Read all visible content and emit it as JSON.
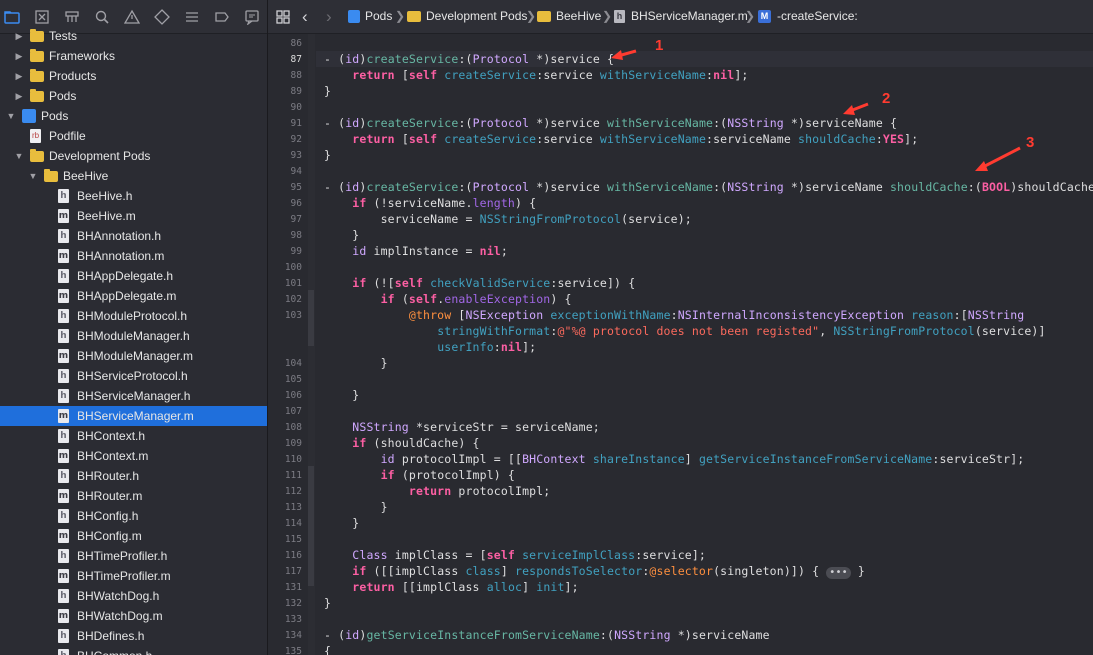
{
  "navigator": {
    "toolbar_icons": [
      "folder-icon",
      "source-control-icon",
      "symbol-icon",
      "find-icon",
      "warning-icon",
      "test-icon",
      "debug-icon",
      "breakpoint-icon",
      "report-icon"
    ],
    "rows": [
      {
        "label": "Tests",
        "kind": "folder",
        "depth": 1,
        "disclosure": "right"
      },
      {
        "label": "Frameworks",
        "kind": "folder",
        "depth": 1,
        "disclosure": "right"
      },
      {
        "label": "Products",
        "kind": "folder",
        "depth": 1,
        "disclosure": "right"
      },
      {
        "label": "Pods",
        "kind": "folder",
        "depth": 1,
        "disclosure": "right"
      },
      {
        "label": "Pods",
        "kind": "project",
        "depth": 0,
        "disclosure": "down"
      },
      {
        "label": "Podfile",
        "kind": "podfile",
        "depth": 1,
        "disclosure": "none"
      },
      {
        "label": "Development Pods",
        "kind": "folder",
        "depth": 1,
        "disclosure": "down"
      },
      {
        "label": "BeeHive",
        "kind": "folder",
        "depth": 2,
        "disclosure": "down"
      },
      {
        "label": "BeeHive.h",
        "kind": "h",
        "depth": 3
      },
      {
        "label": "BeeHive.m",
        "kind": "m",
        "depth": 3
      },
      {
        "label": "BHAnnotation.h",
        "kind": "h",
        "depth": 3
      },
      {
        "label": "BHAnnotation.m",
        "kind": "m",
        "depth": 3
      },
      {
        "label": "BHAppDelegate.h",
        "kind": "h",
        "depth": 3
      },
      {
        "label": "BHAppDelegate.m",
        "kind": "m",
        "depth": 3
      },
      {
        "label": "BHModuleProtocol.h",
        "kind": "h",
        "depth": 3
      },
      {
        "label": "BHModuleManager.h",
        "kind": "h",
        "depth": 3
      },
      {
        "label": "BHModuleManager.m",
        "kind": "m",
        "depth": 3
      },
      {
        "label": "BHServiceProtocol.h",
        "kind": "h",
        "depth": 3
      },
      {
        "label": "BHServiceManager.h",
        "kind": "h",
        "depth": 3
      },
      {
        "label": "BHServiceManager.m",
        "kind": "m",
        "depth": 3,
        "selected": true
      },
      {
        "label": "BHContext.h",
        "kind": "h",
        "depth": 3
      },
      {
        "label": "BHContext.m",
        "kind": "m",
        "depth": 3
      },
      {
        "label": "BHRouter.h",
        "kind": "h",
        "depth": 3
      },
      {
        "label": "BHRouter.m",
        "kind": "m",
        "depth": 3
      },
      {
        "label": "BHConfig.h",
        "kind": "h",
        "depth": 3
      },
      {
        "label": "BHConfig.m",
        "kind": "m",
        "depth": 3
      },
      {
        "label": "BHTimeProfiler.h",
        "kind": "h",
        "depth": 3
      },
      {
        "label": "BHTimeProfiler.m",
        "kind": "m",
        "depth": 3
      },
      {
        "label": "BHWatchDog.h",
        "kind": "h",
        "depth": 3
      },
      {
        "label": "BHWatchDog.m",
        "kind": "m",
        "depth": 3
      },
      {
        "label": "BHDefines.h",
        "kind": "h",
        "depth": 3
      },
      {
        "label": "BHCommon.h",
        "kind": "h",
        "depth": 3
      }
    ]
  },
  "jumpbar": {
    "crumbs": [
      "Pods",
      "Development Pods",
      "BeeHive",
      "BHServiceManager.m",
      "-createService:"
    ],
    "method_badge": "M",
    "file_badge": "h"
  },
  "editor": {
    "current_line": "87",
    "lines": [
      {
        "n": "86",
        "segs": []
      },
      {
        "n": "87",
        "segs": [
          [
            "p",
            "- ("
          ],
          [
            "t",
            "id"
          ],
          [
            "p",
            ")"
          ],
          [
            "f",
            "createService"
          ],
          [
            "p",
            ":("
          ],
          [
            "t",
            "Protocol"
          ],
          [
            "p",
            " *)service {"
          ]
        ]
      },
      {
        "n": "88",
        "segs": [
          [
            "p",
            "    "
          ],
          [
            "k",
            "return"
          ],
          [
            "p",
            " ["
          ],
          [
            "k",
            "self"
          ],
          [
            "p",
            " "
          ],
          [
            "m",
            "createService"
          ],
          [
            "p",
            ":service "
          ],
          [
            "m",
            "withServiceName"
          ],
          [
            "p",
            ":"
          ],
          [
            "k",
            "nil"
          ],
          [
            "p",
            "];"
          ]
        ]
      },
      {
        "n": "89",
        "segs": [
          [
            "p",
            "}"
          ]
        ]
      },
      {
        "n": "90",
        "segs": []
      },
      {
        "n": "91",
        "segs": [
          [
            "p",
            "- ("
          ],
          [
            "t",
            "id"
          ],
          [
            "p",
            ")"
          ],
          [
            "f",
            "createService"
          ],
          [
            "p",
            ":("
          ],
          [
            "t",
            "Protocol"
          ],
          [
            "p",
            " *)service "
          ],
          [
            "f",
            "withServiceName"
          ],
          [
            "p",
            ":("
          ],
          [
            "t",
            "NSString"
          ],
          [
            "p",
            " *)serviceName {"
          ]
        ]
      },
      {
        "n": "92",
        "segs": [
          [
            "p",
            "    "
          ],
          [
            "k",
            "return"
          ],
          [
            "p",
            " ["
          ],
          [
            "k",
            "self"
          ],
          [
            "p",
            " "
          ],
          [
            "m",
            "createService"
          ],
          [
            "p",
            ":service "
          ],
          [
            "m",
            "withServiceName"
          ],
          [
            "p",
            ":serviceName "
          ],
          [
            "m",
            "shouldCache"
          ],
          [
            "p",
            ":"
          ],
          [
            "k",
            "YES"
          ],
          [
            "p",
            "];"
          ]
        ]
      },
      {
        "n": "93",
        "segs": [
          [
            "p",
            "}"
          ]
        ]
      },
      {
        "n": "94",
        "segs": []
      },
      {
        "n": "95",
        "segs": [
          [
            "p",
            "- ("
          ],
          [
            "t",
            "id"
          ],
          [
            "p",
            ")"
          ],
          [
            "f",
            "createService"
          ],
          [
            "p",
            ":("
          ],
          [
            "t",
            "Protocol"
          ],
          [
            "p",
            " *)service "
          ],
          [
            "f",
            "withServiceName"
          ],
          [
            "p",
            ":("
          ],
          [
            "t",
            "NSString"
          ],
          [
            "p",
            " *)serviceName "
          ],
          [
            "f",
            "shouldCache"
          ],
          [
            "p",
            ":("
          ],
          [
            "k",
            "BOOL"
          ],
          [
            "p",
            ")shouldCache {"
          ]
        ]
      },
      {
        "n": "96",
        "segs": [
          [
            "p",
            "    "
          ],
          [
            "k",
            "if"
          ],
          [
            "p",
            " (!serviceName."
          ],
          [
            "r",
            "length"
          ],
          [
            "p",
            ") {"
          ]
        ]
      },
      {
        "n": "97",
        "segs": [
          [
            "p",
            "        serviceName = "
          ],
          [
            "m",
            "NSStringFromProtocol"
          ],
          [
            "p",
            "(service);"
          ]
        ]
      },
      {
        "n": "98",
        "segs": [
          [
            "p",
            "    }"
          ]
        ]
      },
      {
        "n": "99",
        "segs": [
          [
            "p",
            "    "
          ],
          [
            "t",
            "id"
          ],
          [
            "p",
            " implInstance = "
          ],
          [
            "k",
            "nil"
          ],
          [
            "p",
            ";"
          ]
        ]
      },
      {
        "n": "100",
        "segs": []
      },
      {
        "n": "101",
        "segs": [
          [
            "p",
            "    "
          ],
          [
            "k",
            "if"
          ],
          [
            "p",
            " (!["
          ],
          [
            "k",
            "self"
          ],
          [
            "p",
            " "
          ],
          [
            "m",
            "checkValidService"
          ],
          [
            "p",
            ":service]) {"
          ]
        ]
      },
      {
        "n": "102",
        "segs": [
          [
            "p",
            "        "
          ],
          [
            "k",
            "if"
          ],
          [
            "p",
            " ("
          ],
          [
            "k",
            "self"
          ],
          [
            "p",
            "."
          ],
          [
            "r",
            "enableException"
          ],
          [
            "p",
            ") {"
          ]
        ]
      },
      {
        "n": "103",
        "segs": [
          [
            "p",
            "            "
          ],
          [
            "a",
            "@throw"
          ],
          [
            "p",
            " ["
          ],
          [
            "t",
            "NSException"
          ],
          [
            "p",
            " "
          ],
          [
            "m",
            "exceptionWithName"
          ],
          [
            "p",
            ":"
          ],
          [
            "t",
            "NSInternalInconsistencyException"
          ],
          [
            "p",
            " "
          ],
          [
            "m",
            "reason"
          ],
          [
            "p",
            ":["
          ],
          [
            "t",
            "NSString"
          ]
        ]
      },
      {
        "n": "",
        "segs": [
          [
            "p",
            "                "
          ],
          [
            "m",
            "stringWithFormat"
          ],
          [
            "p",
            ":"
          ],
          [
            "s",
            "@\"%@ protocol does not been registed\""
          ],
          [
            "p",
            ", "
          ],
          [
            "m",
            "NSStringFromProtocol"
          ],
          [
            "p",
            "(service)]"
          ]
        ]
      },
      {
        "n": "",
        "segs": [
          [
            "p",
            "                "
          ],
          [
            "m",
            "userInfo"
          ],
          [
            "p",
            ":"
          ],
          [
            "k",
            "nil"
          ],
          [
            "p",
            "];"
          ]
        ]
      },
      {
        "n": "104",
        "segs": [
          [
            "p",
            "        }"
          ]
        ]
      },
      {
        "n": "105",
        "segs": []
      },
      {
        "n": "106",
        "segs": [
          [
            "p",
            "    }"
          ]
        ]
      },
      {
        "n": "107",
        "segs": []
      },
      {
        "n": "108",
        "segs": [
          [
            "p",
            "    "
          ],
          [
            "t",
            "NSString"
          ],
          [
            "p",
            " *serviceStr = serviceName;"
          ]
        ]
      },
      {
        "n": "109",
        "segs": [
          [
            "p",
            "    "
          ],
          [
            "k",
            "if"
          ],
          [
            "p",
            " (shouldCache) {"
          ]
        ]
      },
      {
        "n": "110",
        "segs": [
          [
            "p",
            "        "
          ],
          [
            "t",
            "id"
          ],
          [
            "p",
            " protocolImpl = [["
          ],
          [
            "t",
            "BHContext"
          ],
          [
            "p",
            " "
          ],
          [
            "m",
            "shareInstance"
          ],
          [
            "p",
            "] "
          ],
          [
            "m",
            "getServiceInstanceFromServiceName"
          ],
          [
            "p",
            ":serviceStr];"
          ]
        ]
      },
      {
        "n": "111",
        "segs": [
          [
            "p",
            "        "
          ],
          [
            "k",
            "if"
          ],
          [
            "p",
            " (protocolImpl) {"
          ]
        ]
      },
      {
        "n": "112",
        "segs": [
          [
            "p",
            "            "
          ],
          [
            "k",
            "return"
          ],
          [
            "p",
            " protocolImpl;"
          ]
        ]
      },
      {
        "n": "113",
        "segs": [
          [
            "p",
            "        }"
          ]
        ]
      },
      {
        "n": "114",
        "segs": [
          [
            "p",
            "    }"
          ]
        ]
      },
      {
        "n": "115",
        "segs": []
      },
      {
        "n": "116",
        "segs": [
          [
            "p",
            "    "
          ],
          [
            "t",
            "Class"
          ],
          [
            "p",
            " implClass = ["
          ],
          [
            "k",
            "self"
          ],
          [
            "p",
            " "
          ],
          [
            "m",
            "serviceImplClass"
          ],
          [
            "p",
            ":service];"
          ]
        ]
      },
      {
        "n": "117",
        "segs": [
          [
            "p",
            "    "
          ],
          [
            "k",
            "if"
          ],
          [
            "p",
            " ([[implClass "
          ],
          [
            "m",
            "class"
          ],
          [
            "p",
            "] "
          ],
          [
            "m",
            "respondsToSelector"
          ],
          [
            "p",
            ":"
          ],
          [
            "a",
            "@selector"
          ],
          [
            "p",
            "(singleton)]) { "
          ],
          [
            "pill",
            "•••"
          ],
          [
            "p",
            " }"
          ]
        ]
      },
      {
        "n": "131",
        "segs": [
          [
            "p",
            "    "
          ],
          [
            "k",
            "return"
          ],
          [
            "p",
            " [[implClass "
          ],
          [
            "m",
            "alloc"
          ],
          [
            "p",
            "] "
          ],
          [
            "m",
            "init"
          ],
          [
            "p",
            "];"
          ]
        ]
      },
      {
        "n": "132",
        "segs": [
          [
            "p",
            "}"
          ]
        ]
      },
      {
        "n": "133",
        "segs": []
      },
      {
        "n": "134",
        "segs": [
          [
            "p",
            "- ("
          ],
          [
            "t",
            "id"
          ],
          [
            "p",
            ")"
          ],
          [
            "f",
            "getServiceInstanceFromServiceName"
          ],
          [
            "p",
            ":("
          ],
          [
            "t",
            "NSString"
          ],
          [
            "p",
            " *)serviceName"
          ]
        ]
      },
      {
        "n": "135",
        "segs": [
          [
            "p",
            "{"
          ]
        ]
      }
    ]
  },
  "annotations": [
    "1",
    "2",
    "3"
  ],
  "colors": {
    "arrow": "#ff3b30",
    "selection": "#1f6fdc",
    "editor_bg": "#292a30"
  }
}
